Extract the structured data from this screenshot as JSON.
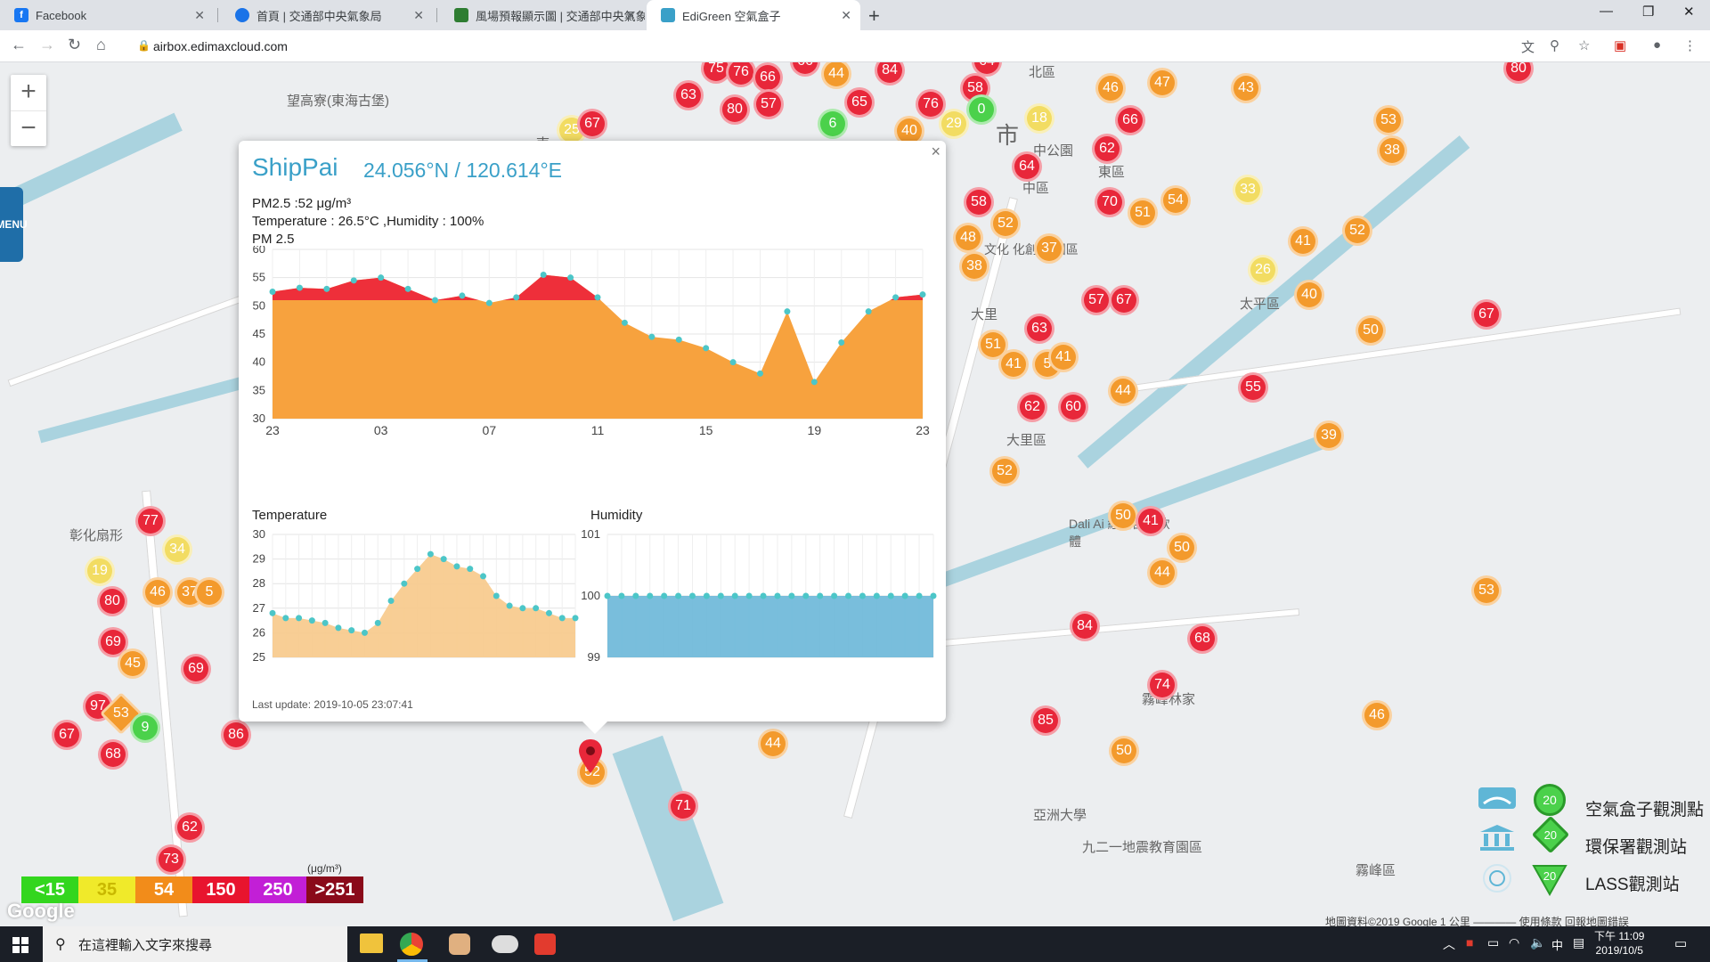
{
  "browser": {
    "tabs": [
      {
        "title": "Facebook",
        "icon": "facebook-icon",
        "color": "#1877f2"
      },
      {
        "title": "首頁 | 交通部中央氣象局",
        "icon": "cwb-icon",
        "color": "#1a73e8"
      },
      {
        "title": "風場預報顯示圖 | 交通部中央氣象",
        "icon": "wind-icon",
        "color": "#2e7d32"
      },
      {
        "title": "EdiGreen 空氣盒子",
        "icon": "edigreen-icon",
        "color": "#3aa0c8"
      }
    ],
    "url": "airbox.edimaxcloud.com"
  },
  "menu_label": "MENU",
  "popup": {
    "station": "ShipPai",
    "coords": "24.056°N / 120.614°E",
    "pm_line": "PM2.5 :52 μg/m³",
    "weather_line": "Temperature : 26.5°C ,Humidity : 100%",
    "pm_chart_label": "PM 2.5",
    "temp_chart_label": "Temperature",
    "hum_chart_label": "Humidity",
    "last_update": "Last update: 2019-10-05 23:07:41"
  },
  "chart_data": [
    {
      "type": "area",
      "title": "PM 2.5",
      "x": [
        "23",
        "",
        "",
        "",
        "03",
        "",
        "",
        "",
        "07",
        "",
        "",
        "",
        "11",
        "",
        "",
        "",
        "15",
        "",
        "",
        "",
        "19",
        "",
        "",
        "",
        "23"
      ],
      "xticks": [
        "23",
        "03",
        "07",
        "11",
        "15",
        "19",
        "23"
      ],
      "values": [
        52.5,
        53.2,
        53,
        54.5,
        55,
        53,
        51,
        51.8,
        50.5,
        51.5,
        55.5,
        55,
        51.5,
        47,
        44.5,
        44,
        42.5,
        40,
        38,
        49,
        36.5,
        43.5,
        49,
        51.5,
        52
      ],
      "threshold": 51,
      "ylim": [
        30,
        60
      ],
      "yticks": [
        "30",
        "35",
        "40",
        "45",
        "50",
        "55",
        "60"
      ],
      "colors": {
        "area": "#f7a23e",
        "above": "#ee2f3a",
        "point": "#4cc6c8"
      }
    },
    {
      "type": "area",
      "title": "Temperature",
      "values": [
        26.8,
        26.6,
        26.6,
        26.5,
        26.4,
        26.2,
        26.1,
        26,
        26.4,
        27.3,
        28,
        28.6,
        29.2,
        29,
        28.7,
        28.6,
        28.3,
        27.5,
        27.1,
        27,
        27,
        26.8,
        26.6,
        26.6
      ],
      "ylim": [
        25,
        30
      ],
      "yticks": [
        "25",
        "26",
        "27",
        "28",
        "29",
        "30"
      ],
      "colors": {
        "area": "#f7c98a",
        "point": "#4cc6c8"
      }
    },
    {
      "type": "area",
      "title": "Humidity",
      "values": [
        100,
        100,
        100,
        100,
        100,
        100,
        100,
        100,
        100,
        100,
        100,
        100,
        100,
        100,
        100,
        100,
        100,
        100,
        100,
        100,
        100,
        100,
        100,
        100
      ],
      "ylim": [
        99,
        101
      ],
      "yticks": [
        "99",
        "100",
        "101"
      ],
      "colors": {
        "area": "#6ab7d8",
        "point": "#4cc6c8"
      }
    }
  ],
  "map": {
    "places": [
      "望高寮(東海古堡)",
      "北區",
      "東區",
      "中區",
      "太平區",
      "大里區",
      "霧峰區",
      "彰化扇形",
      "亞洲大學",
      "九二一地震教育園區",
      "霧峰林家",
      "南",
      "市",
      "中公園",
      "大里",
      "Dali Ai 經濟部中軟體",
      "文化 化創意 園區"
    ],
    "markers": [
      "75",
      "76",
      "66",
      "63",
      "66",
      "80",
      "57",
      "65",
      "44",
      "84",
      "76",
      "64",
      "58",
      "0",
      "18",
      "66",
      "46",
      "47",
      "43",
      "80",
      "25",
      "67",
      "29",
      "40",
      "6",
      "62",
      "64",
      "53",
      "38",
      "70",
      "51",
      "54",
      "33",
      "58",
      "52",
      "48",
      "37",
      "41",
      "52",
      "38",
      "26",
      "40",
      "57",
      "67",
      "63",
      "51",
      "41",
      "5",
      "41",
      "50",
      "67",
      "44",
      "62",
      "60",
      "55",
      "52",
      "39",
      "50",
      "41",
      "50",
      "44",
      "84",
      "68",
      "74",
      "85",
      "50",
      "46",
      "53",
      "44",
      "71",
      "52",
      "77",
      "34",
      "19",
      "80",
      "46",
      "37",
      "5",
      "69",
      "45",
      "69",
      "97",
      "53",
      "9",
      "67",
      "68",
      "86",
      "62",
      "73"
    ]
  },
  "aq_legend": [
    {
      "label": "<15",
      "color": "#33d61e"
    },
    {
      "label": "35",
      "color": "#f0ea2a"
    },
    {
      "label": "54",
      "color": "#f28c1a"
    },
    {
      "label": "150",
      "color": "#e8142e"
    },
    {
      "label": "250",
      "color": "#c21fd6"
    },
    {
      "label": ">251",
      "color": "#8a0a1a"
    }
  ],
  "aq_unit": "(μg/m³)",
  "station_legend": [
    {
      "label": "空氣盒子觀測點",
      "value": "20"
    },
    {
      "label": "環保署觀測站",
      "value": "20"
    },
    {
      "label": "LASS觀測站",
      "value": "20"
    }
  ],
  "attribution": "地圖資料©2019 Google   1 公里 ————   使用條款   回報地圖錯誤",
  "google_logo": "Google",
  "taskbar": {
    "search_placeholder": "在這裡輸入文字來搜尋",
    "time": "下午 11:09",
    "date": "2019/10/5",
    "ime": "中"
  }
}
